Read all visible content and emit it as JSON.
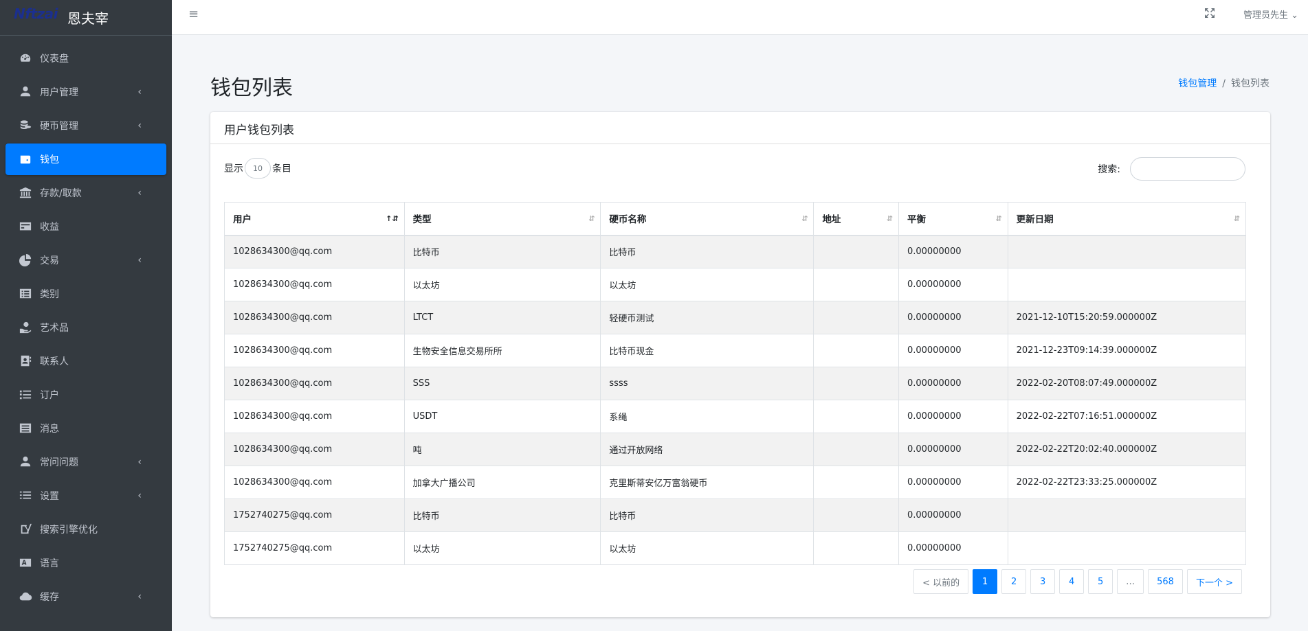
{
  "brand": {
    "logo": "Nftzai",
    "name": "恩夫宰"
  },
  "sidebar": {
    "items": [
      {
        "label": "仪表盘",
        "icon": "dashboard-icon",
        "arrow": ""
      },
      {
        "label": "用户管理",
        "icon": "user-icon",
        "arrow": "‹"
      },
      {
        "label": "硬币管理",
        "icon": "coins-icon",
        "arrow": "‹"
      },
      {
        "label": "钱包",
        "icon": "wallet-icon",
        "arrow": ""
      },
      {
        "label": "存款/取款",
        "icon": "bank-icon",
        "arrow": "‹"
      },
      {
        "label": "收益",
        "icon": "money-card-icon",
        "arrow": ""
      },
      {
        "label": "交易",
        "icon": "pie-chart-icon",
        "arrow": "‹"
      },
      {
        "label": "类别",
        "icon": "list-alt-icon",
        "arrow": ""
      },
      {
        "label": "艺术品",
        "icon": "hand-holding-icon",
        "arrow": ""
      },
      {
        "label": "联系人",
        "icon": "address-book-icon",
        "arrow": ""
      },
      {
        "label": "订户",
        "icon": "list-ul-icon",
        "arrow": ""
      },
      {
        "label": "消息",
        "icon": "message-list-icon",
        "arrow": ""
      },
      {
        "label": "常问问题",
        "icon": "user-question-icon",
        "arrow": "‹"
      },
      {
        "label": "设置",
        "icon": "list-icon",
        "arrow": "‹"
      },
      {
        "label": "搜索引擎优化",
        "icon": "yoast-icon",
        "arrow": ""
      },
      {
        "label": "语言",
        "icon": "language-icon",
        "arrow": ""
      },
      {
        "label": "缓存",
        "icon": "cloud-icon",
        "arrow": "‹"
      }
    ],
    "active_index": 3
  },
  "topbar": {
    "menu_icon": "≡",
    "user": "管理员先生",
    "user_caret": "⌄"
  },
  "page": {
    "title": "钱包列表"
  },
  "breadcrumb": {
    "parent": "钱包管理",
    "separator": "/",
    "current": "钱包列表"
  },
  "card": {
    "title": "用户钱包列表"
  },
  "length": {
    "prefix": "显示",
    "value": "10",
    "suffix": "条目"
  },
  "search": {
    "label": "搜索:",
    "value": ""
  },
  "table": {
    "columns": [
      "用户",
      "类型",
      "硬币名称",
      "地址",
      "平衡",
      "更新日期"
    ],
    "rows": [
      [
        "1028634300@qq.com",
        "比特币",
        "比特币",
        "",
        "0.00000000",
        ""
      ],
      [
        "1028634300@qq.com",
        "以太坊",
        "以太坊",
        "",
        "0.00000000",
        ""
      ],
      [
        "1028634300@qq.com",
        "LTCT",
        "轻硬币测试",
        "",
        "0.00000000",
        "2021-12-10T15:20:59.000000Z"
      ],
      [
        "1028634300@qq.com",
        "生物安全信息交易所所",
        "比特币现金",
        "",
        "0.00000000",
        "2021-12-23T09:14:39.000000Z"
      ],
      [
        "1028634300@qq.com",
        "SSS",
        "ssss",
        "",
        "0.00000000",
        "2022-02-20T08:07:49.000000Z"
      ],
      [
        "1028634300@qq.com",
        "USDT",
        "系绳",
        "",
        "0.00000000",
        "2022-02-22T07:16:51.000000Z"
      ],
      [
        "1028634300@qq.com",
        "吨",
        "通过开放网络",
        "",
        "0.00000000",
        "2022-02-22T20:02:40.000000Z"
      ],
      [
        "1028634300@qq.com",
        "加拿大广播公司",
        "克里斯蒂安亿万富翁硬币",
        "",
        "0.00000000",
        "2022-02-22T23:33:25.000000Z"
      ],
      [
        "1752740275@qq.com",
        "比特币",
        "比特币",
        "",
        "0.00000000",
        ""
      ],
      [
        "1752740275@qq.com",
        "以太坊",
        "以太坊",
        "",
        "0.00000000",
        ""
      ]
    ]
  },
  "pagination": {
    "prev": "< 以前的",
    "pages": [
      "1",
      "2",
      "3",
      "4",
      "5",
      "…",
      "568"
    ],
    "active": "1",
    "next": "下一个 >"
  },
  "colors": {
    "sidebar_bg": "#343a40",
    "accent": "#007bff",
    "page_bg": "#f4f6f9"
  }
}
